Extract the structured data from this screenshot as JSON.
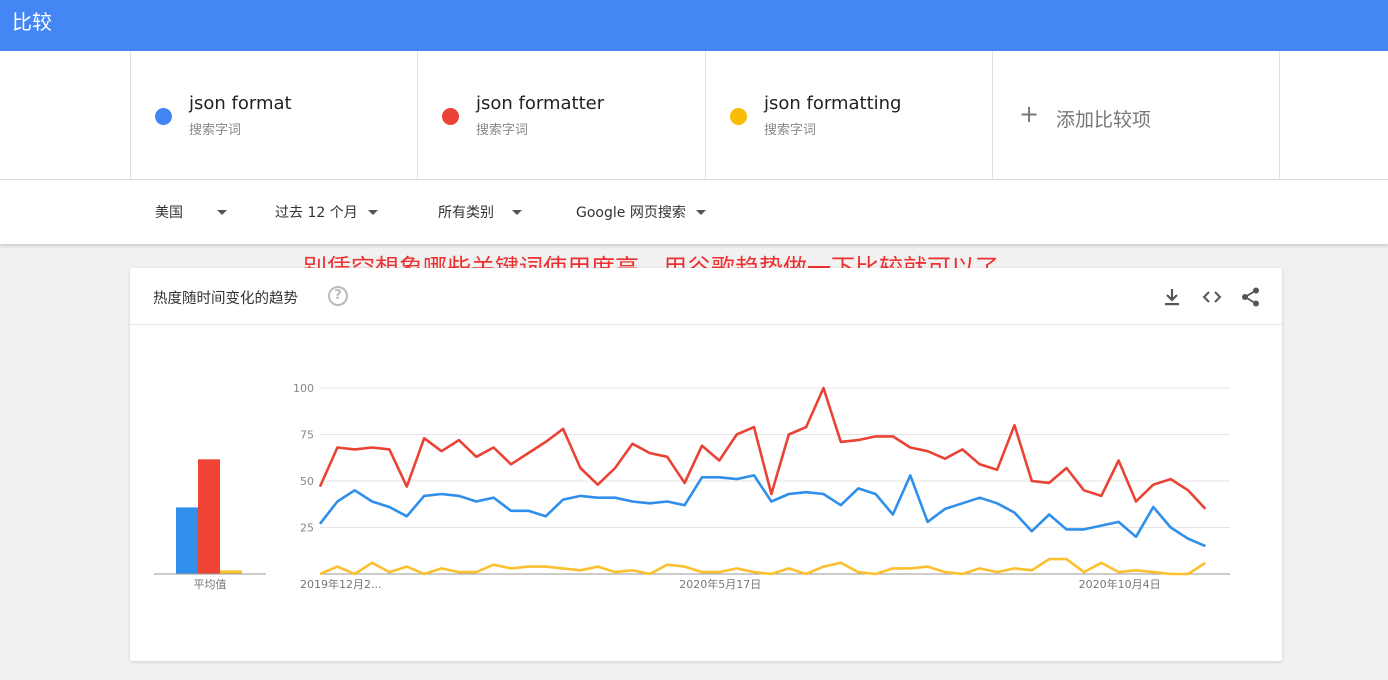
{
  "header": {
    "title": "比较"
  },
  "terms": [
    {
      "name": "json format",
      "sub": "搜索字词",
      "color": "#4285f4"
    },
    {
      "name": "json formatter",
      "sub": "搜索字词",
      "color": "#ea4335"
    },
    {
      "name": "json formatting",
      "sub": "搜索字词",
      "color": "#fbbc04"
    }
  ],
  "add_term": {
    "label": "添加比较项",
    "icon": "plus-icon"
  },
  "filters": {
    "region": "美国",
    "time": "过去 12 个月",
    "category": "所有类别",
    "search_type": "Google 网页搜索"
  },
  "annotation": "别凭空想象哪些关键词使用度高，用谷歌趋势做一下比较就可以了",
  "card": {
    "title": "热度随时间变化的趋势",
    "help_icon": "help-icon",
    "actions": [
      "download-icon",
      "embed-icon",
      "share-icon"
    ]
  },
  "chart_data": [
    {
      "type": "bar",
      "categories": [
        "平均值"
      ],
      "series": [
        {
          "name": "json format",
          "values": [
            36
          ],
          "color": "#2f8fea"
        },
        {
          "name": "json formatter",
          "values": [
            62
          ],
          "color": "#f04336"
        },
        {
          "name": "json formatting",
          "values": [
            2
          ],
          "color": "#fbc02d"
        }
      ],
      "xlabel": "平均值",
      "ylim": [
        0,
        100
      ]
    },
    {
      "type": "line",
      "x_labels": [
        "2019年12月2...",
        "2020年5月17日",
        "2020年10月4日"
      ],
      "x_label_positions": [
        0,
        23,
        46
      ],
      "y_ticks": [
        25,
        50,
        75,
        100
      ],
      "ylim": [
        0,
        100
      ],
      "grid": true,
      "series": [
        {
          "name": "json format",
          "color": "#2f8fea",
          "values": [
            27,
            39,
            45,
            39,
            36,
            31,
            42,
            43,
            42,
            39,
            41,
            34,
            34,
            31,
            40,
            42,
            41,
            41,
            39,
            38,
            39,
            37,
            52,
            52,
            51,
            53,
            39,
            43,
            44,
            43,
            37,
            46,
            43,
            32,
            53,
            28,
            35,
            38,
            41,
            38,
            33,
            23,
            32,
            24,
            24,
            26,
            28,
            20,
            36,
            25,
            19,
            15
          ]
        },
        {
          "name": "json formatter",
          "color": "#ea4335",
          "values": [
            47,
            68,
            67,
            68,
            67,
            47,
            73,
            66,
            72,
            63,
            68,
            59,
            65,
            71,
            78,
            57,
            48,
            57,
            70,
            65,
            63,
            49,
            69,
            61,
            75,
            79,
            43,
            75,
            79,
            100,
            71,
            72,
            74,
            74,
            68,
            66,
            62,
            67,
            59,
            56,
            80,
            50,
            49,
            57,
            45,
            42,
            61,
            39,
            48,
            51,
            45,
            35
          ]
        },
        {
          "name": "json formatting",
          "color": "#fbc02d",
          "values": [
            0,
            4,
            0,
            6,
            1,
            4,
            0,
            3,
            1,
            1,
            5,
            3,
            4,
            4,
            3,
            2,
            4,
            1,
            2,
            0,
            5,
            4,
            1,
            1,
            3,
            1,
            0,
            3,
            0,
            4,
            6,
            1,
            0,
            3,
            3,
            4,
            1,
            0,
            3,
            1,
            3,
            2,
            8,
            8,
            1,
            6,
            1,
            2,
            1,
            0,
            0,
            6
          ]
        }
      ]
    }
  ]
}
